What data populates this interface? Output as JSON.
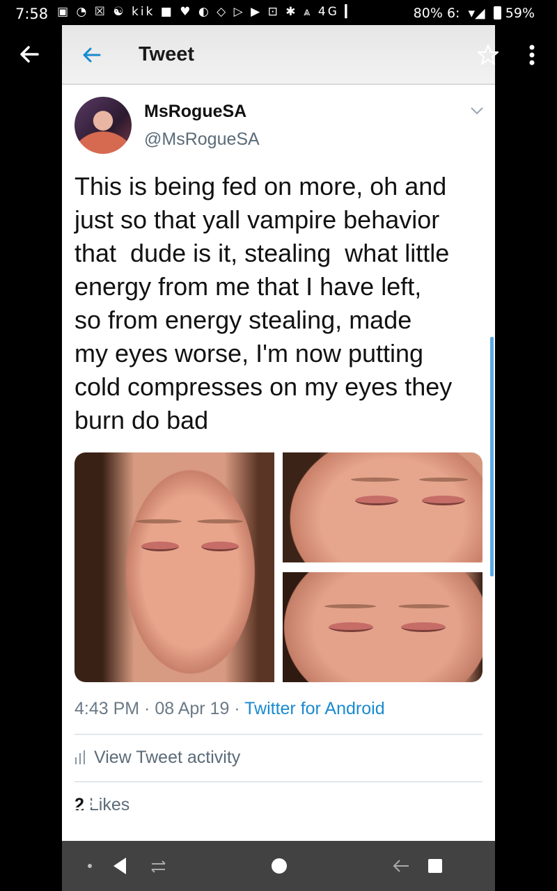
{
  "status_bar": {
    "time": "7:58",
    "icons": "▣ ◔ ☒ ☯ kik ■ ♥ ◐ ◇ ▷ ▶ ⊡ ✱ ⩓ 4G ▎",
    "battery_other": "80%",
    "extra": "6:",
    "battery": "59%"
  },
  "screenshot": {
    "header_title": "Tweet",
    "author": {
      "name": "MsRogueSA",
      "handle": "@MsRogueSA"
    },
    "tweet_lines": [
      "This is being fed on more, oh and",
      "just so that yall vampire behavior",
      "that  dude is it, stealing  what little",
      "energy from me that I have left,",
      "so from energy stealing, made",
      "my eyes worse, I'm now putting",
      "cold compresses on my eyes they",
      "burn do bad"
    ],
    "meta": {
      "time": "4:43 PM",
      "date": "08 Apr 19",
      "separator": " · ",
      "source": "Twitter for Android"
    },
    "activity_label": "View Tweet activity",
    "likes": {
      "count": "2",
      "label": "Likes"
    }
  },
  "icons": {
    "outer_back": "arrow-back-icon",
    "outer_menu": "more-vert-icon",
    "header_back": "arrow-back-icon",
    "favorite": "star-outline-icon",
    "share": "share-icon",
    "edit": "tune-icon",
    "lens": "lens-icon",
    "delete": "trash-icon"
  },
  "colors": {
    "link": "#1a8ad0",
    "secondary_text": "#5b6b78",
    "accent": "#5aaae6"
  }
}
